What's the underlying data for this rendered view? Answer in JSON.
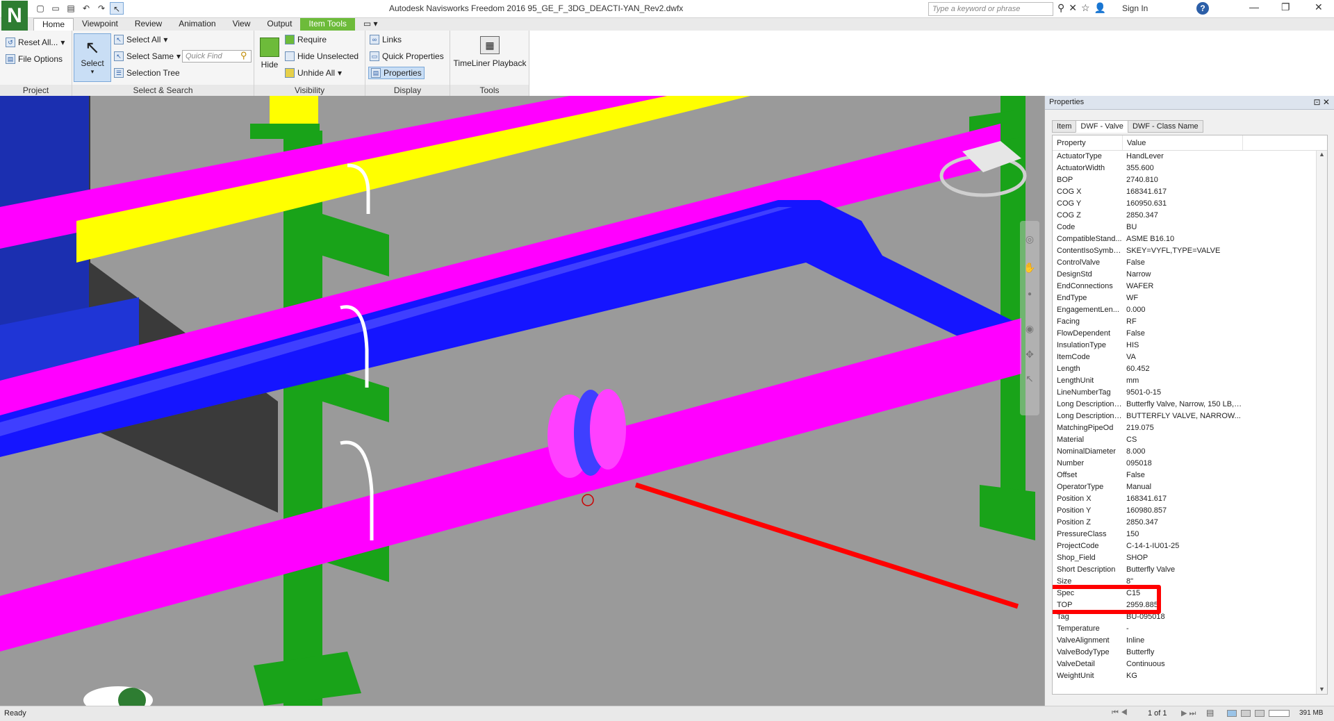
{
  "window": {
    "title": "Autodesk Navisworks Freedom 2016    95_GE_F_3DG_DEACTI-YAN_Rev2.dwfx",
    "search_placeholder": "Type a keyword or phrase",
    "sign_in": "Sign In",
    "app_logo": "N"
  },
  "tabs": [
    "Home",
    "Viewpoint",
    "Review",
    "Animation",
    "View",
    "Output",
    "Item Tools"
  ],
  "ribbon": {
    "project": {
      "label": "Project",
      "reset_all": "Reset All...",
      "file_options": "File Options"
    },
    "select_search": {
      "label": "Select & Search",
      "select": "Select",
      "select_all": "Select All",
      "select_same": "Select Same",
      "selection_tree": "Selection Tree",
      "quick_find_placeholder": "Quick Find"
    },
    "visibility": {
      "label": "Visibility",
      "hide": "Hide",
      "require": "Require",
      "hide_unselected": "Hide Unselected",
      "unhide_all": "Unhide All"
    },
    "display": {
      "label": "Display",
      "links": "Links",
      "quick_properties": "Quick Properties",
      "properties": "Properties"
    },
    "tools": {
      "label": "Tools",
      "timeliner": "TimeLiner Playback"
    }
  },
  "properties": {
    "title": "Properties",
    "tabs": [
      "Item",
      "DWF - Valve",
      "DWF - Class Name"
    ],
    "active_tab": "DWF - Valve",
    "columns": [
      "Property",
      "Value"
    ],
    "rows": [
      [
        "ActuatorType",
        "HandLever"
      ],
      [
        "ActuatorWidth",
        "355.600"
      ],
      [
        "BOP",
        "2740.810"
      ],
      [
        "COG X",
        "168341.617"
      ],
      [
        "COG Y",
        "160950.631"
      ],
      [
        "COG Z",
        "2850.347"
      ],
      [
        "Code",
        "BU"
      ],
      [
        "CompatibleStand...",
        "ASME B16.10"
      ],
      [
        "ContentIsoSymbo...",
        "SKEY=VYFL,TYPE=VALVE"
      ],
      [
        "ControlValve",
        "False"
      ],
      [
        "DesignStd",
        "Narrow"
      ],
      [
        "EndConnections",
        "WAFER"
      ],
      [
        "EndType",
        "WF"
      ],
      [
        "EngagementLen...",
        "0.000"
      ],
      [
        "Facing",
        "RF"
      ],
      [
        "FlowDependent",
        "False"
      ],
      [
        "InsulationType",
        "HIS"
      ],
      [
        "ItemCode",
        "VA"
      ],
      [
        "Length",
        "60.452"
      ],
      [
        "LengthUnit",
        "mm"
      ],
      [
        "LineNumberTag",
        "9501-0-15"
      ],
      [
        "Long Description ...",
        "Butterfly Valve, Narrow, 150 LB, ..."
      ],
      [
        "Long Description ...",
        "BUTTERFLY VALVE, NARROW..."
      ],
      [
        "MatchingPipeOd",
        "219.075"
      ],
      [
        "Material",
        "CS"
      ],
      [
        "NominalDiameter",
        "8.000"
      ],
      [
        "Number",
        "095018"
      ],
      [
        "Offset",
        "False"
      ],
      [
        "OperatorType",
        "Manual"
      ],
      [
        "Position X",
        "168341.617"
      ],
      [
        "Position Y",
        "160980.857"
      ],
      [
        "Position Z",
        "2850.347"
      ],
      [
        "PressureClass",
        "150"
      ],
      [
        "ProjectCode",
        "C-14-1-IU01-25"
      ],
      [
        "Shop_Field",
        "SHOP"
      ],
      [
        "Short Description",
        "Butterfly Valve"
      ],
      [
        "Size",
        "8\""
      ],
      [
        "Spec",
        "C15"
      ],
      [
        "TOP",
        "2959.885"
      ],
      [
        "Tag",
        "BU-095018"
      ],
      [
        "Temperature",
        "-"
      ],
      [
        "ValveAlignment",
        "Inline"
      ],
      [
        "ValveBodyType",
        "Butterfly"
      ],
      [
        "ValveDetail",
        "Continuous"
      ],
      [
        "WeightUnit",
        "KG"
      ]
    ]
  },
  "status": {
    "text": "Ready",
    "page": "1 of 1",
    "memory": "391 MB"
  }
}
